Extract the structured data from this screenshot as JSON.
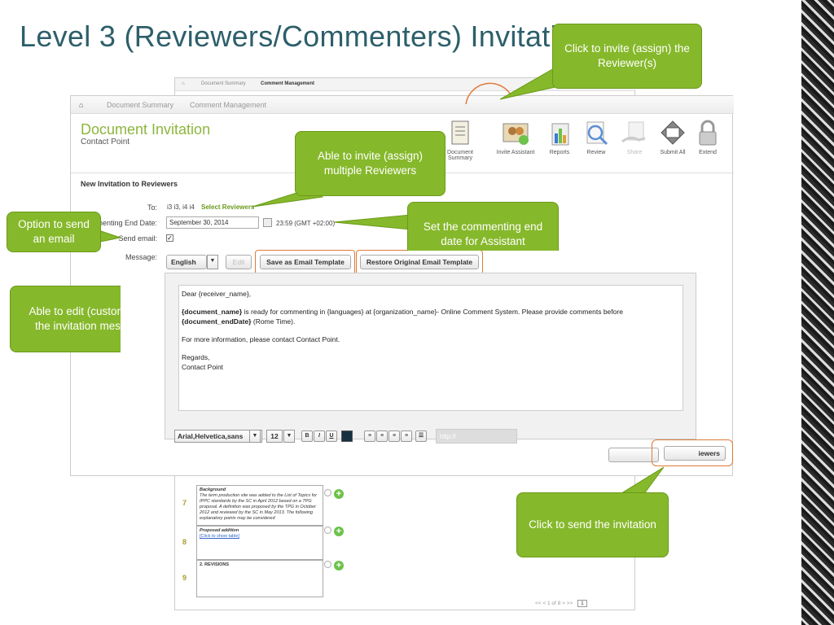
{
  "slide_title": "Level 3 (Reviewers/Commenters) Invitation",
  "bg_breadcrumb": {
    "home": "⌂",
    "item1": "Document Summary",
    "item2": "Comment Management"
  },
  "bg_rows": [
    {
      "num": "7",
      "title": "Background",
      "text": "The term production site was added to the List of Topics for IPPC standards by the SC in April 2012 based on a TPG proposal. A definition was proposed by the TPG in October 2012 and reviewed by the SC in May 2013. The following explanatory points may be considered"
    },
    {
      "num": "8",
      "title": "Proposed addition",
      "text": "[Click to show table]"
    },
    {
      "num": "9",
      "title": "2. REVISIONS",
      "text": ""
    }
  ],
  "pager": {
    "text": "<<  <  1 of 8  >  >>",
    "page": "1"
  },
  "breadcrumb": {
    "home": "⌂",
    "item1": "Document Summary",
    "item2": "Comment Management"
  },
  "doc_title": "Document Invitation",
  "doc_subtitle": "Contact Point",
  "toolbar": [
    {
      "label": "Document Summary",
      "icon": "document-icon"
    },
    {
      "label": "Invite Assistant",
      "icon": "invite-assistant-icon"
    },
    {
      "label": "Reports",
      "icon": "reports-icon"
    },
    {
      "label": "Review",
      "icon": "review-icon"
    },
    {
      "label": "Share",
      "icon": "share-icon"
    },
    {
      "label": "Submit All",
      "icon": "submit-all-icon"
    },
    {
      "label": "Extend",
      "icon": "lock-icon"
    }
  ],
  "section_title": "New Invitation to Reviewers",
  "form": {
    "to_label": "To:",
    "to_value": "i3 i3, i4 i4",
    "select_reviewers": "Select Reviewers",
    "end_date_label": "menting End Date:",
    "end_date_value": "September 30, 2014",
    "time_value": "23:59 (GMT +02:00)",
    "send_email_label": "Send email:",
    "send_email_check": "✓",
    "message_label": "Message:"
  },
  "buttons": {
    "language": "English",
    "edit": "Edit",
    "save_template": "Save as Email Template",
    "restore_template": "Restore Original Email Template",
    "cancel": "Cancel",
    "invite": "Invite Reviewers",
    "invite_visible": "iewers"
  },
  "email": {
    "greeting": "Dear {receiver_name},",
    "p1_bold1": "{document_name}",
    "p1_mid": " is ready for commenting in {languages} at {organization_name}- Online Comment System. Please provide comments before ",
    "p1_bold2": "{document_endDate}",
    "p1_end": " (Rome Time).",
    "p2": "For more information, please contact Contact Point.",
    "p3a": "Regards,",
    "p3b": "Contact Point"
  },
  "editor_toolbar": {
    "font": "Arial,Helvetica,sans",
    "size": "12",
    "bold": "B",
    "italic": "I",
    "underline": "U",
    "url_placeholder": "http://"
  },
  "callouts": {
    "c1": "Click to invite (assign) the Reviewer(s)",
    "c2": "Able to invite (assign) multiple Reviewers",
    "c3": "Option to send an email",
    "c4": "Set the commenting end date for Assistant",
    "c5": "Able to edit (customize) the invitation message",
    "c5_visible": "Able to edit (custor the invitation mes",
    "c6": "Click to send the invitation"
  },
  "colors": {
    "accent": "#86b82b",
    "title": "#2d5f6a",
    "highlight": "#e0793a"
  }
}
